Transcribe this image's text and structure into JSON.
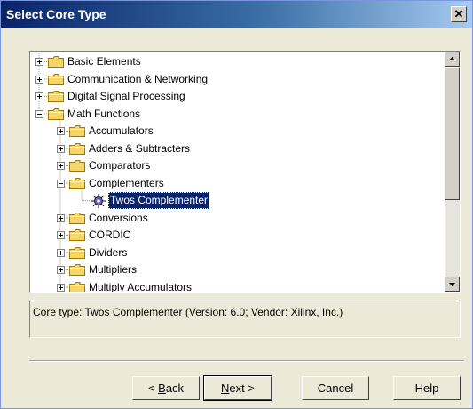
{
  "window": {
    "title": "Select Core Type",
    "close_glyph": "✕"
  },
  "tree": {
    "items": [
      {
        "label": "Basic Elements",
        "expander": "plus",
        "selected": false
      },
      {
        "label": "Communication & Networking",
        "expander": "plus",
        "selected": false
      },
      {
        "label": "Digital Signal Processing",
        "expander": "plus",
        "selected": false
      },
      {
        "label": "Math Functions",
        "expander": "minus",
        "selected": false
      },
      {
        "label": "Accumulators",
        "expander": "plus",
        "selected": false
      },
      {
        "label": "Adders & Subtracters",
        "expander": "plus",
        "selected": false
      },
      {
        "label": "Comparators",
        "expander": "plus",
        "selected": false
      },
      {
        "label": "Complementers",
        "expander": "minus",
        "selected": false
      },
      {
        "label": "Twos Complementer",
        "expander": "none",
        "selected": true
      },
      {
        "label": "Conversions",
        "expander": "plus",
        "selected": false
      },
      {
        "label": "CORDIC",
        "expander": "plus",
        "selected": false
      },
      {
        "label": "Dividers",
        "expander": "plus",
        "selected": false
      },
      {
        "label": "Multipliers",
        "expander": "plus",
        "selected": false
      },
      {
        "label": "Multiply Accumulators",
        "expander": "plus",
        "selected": false
      }
    ]
  },
  "status": {
    "text": "Core type: Twos Complementer (Version: 6.0; Vendor: Xilinx, Inc.)"
  },
  "buttons": {
    "back": {
      "prefix": "< ",
      "mnemonic": "B",
      "rest": "ack"
    },
    "next": {
      "mnemonic": "N",
      "rest": "ext >"
    },
    "cancel": {
      "label": "Cancel"
    },
    "help": {
      "label": "Help"
    }
  },
  "colors": {
    "selection": "#0A246A",
    "folder": "#F7D566",
    "face": "#ECE9D8"
  }
}
